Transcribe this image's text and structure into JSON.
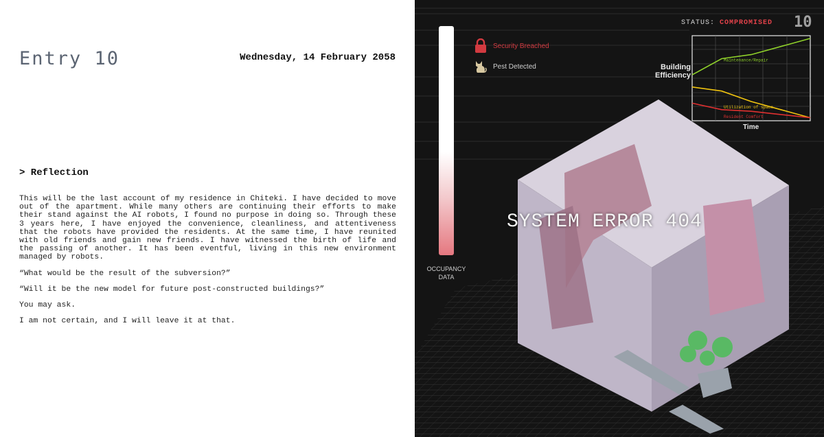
{
  "journal": {
    "entry_title": "Entry 10",
    "date": "Wednesday, 14 February 2058",
    "section_heading": "> Reflection",
    "paragraphs": [
      "This will be the last account of my residence in Chiteki. I have decided to move out of the apartment. While many others are continuing their efforts to make their stand against the AI robots, I found no purpose in doing so. Through these 3 years here, I have enjoyed the convenience, cleanliness, and attentiveness that the robots have provided the residents. At the same time, I have reunited with old friends and gain new friends. I have witnessed the birth of life and the passing of another. It has been eventful, living in this new environment managed by robots."
    ],
    "questions": [
      "“What would be the result of the subversion?”",
      "“Will it be the new model for future post-constructed buildings?”",
      "You may ask."
    ],
    "closing": "I am not certain, and I will leave it at that."
  },
  "dashboard": {
    "status_label": "STATUS:",
    "status_value": "COMPROMISED",
    "entry_number": "10",
    "alerts": {
      "security": "Security Breached",
      "pest": "Pest Detected"
    },
    "occupancy_label_line1": "OCCUPANCY",
    "occupancy_label_line2": "DATA",
    "error_message": "SYSTEM ERROR 404",
    "colors": {
      "alert": "#d23a40",
      "status": "#e4424a",
      "background": "#141414"
    },
    "icons": [
      "lock-icon",
      "cat-icon"
    ]
  },
  "chart_data": {
    "type": "line",
    "ylabel": "Building Efficiency",
    "xlabel": "Time",
    "series": [
      {
        "name": "Maintenance/Repair",
        "color": "#8fd12a",
        "values": [
          0.55,
          0.75,
          0.8,
          0.9,
          1.0
        ]
      },
      {
        "name": "Utilization of space",
        "color": "#f1c40f",
        "values": [
          0.4,
          0.35,
          0.22,
          0.12,
          0.02
        ]
      },
      {
        "name": "Resident Comfort",
        "color": "#e03030",
        "values": [
          0.2,
          0.12,
          0.1,
          0.06,
          0.02
        ]
      }
    ]
  }
}
